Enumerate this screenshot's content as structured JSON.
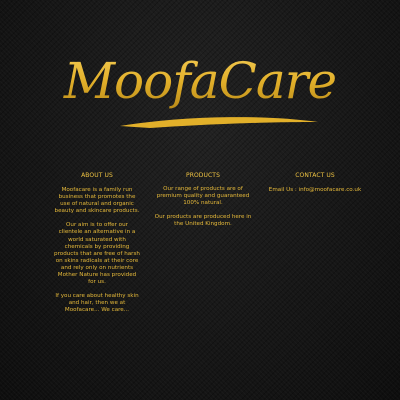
{
  "logo": {
    "text": "MoofaCare",
    "color": "#e3b32b"
  },
  "about": {
    "heading": "ABOUT US",
    "paragraphs": [
      "Moofacare is a family run business that promotes the use of natural and organic beauty and skincare products.",
      "Our aim is to offer our clientele an alternative in a world saturated with chemicals by providing products that are free of harsh on skins radicals at their core and rely only on nutrients Mother Nature has provided for us.",
      "If you care about healthy skin and hair, then we at Moofacare... We care..."
    ]
  },
  "products": {
    "heading": "PRODUCTS",
    "paragraphs": [
      "Our range of products are of premium quality and guaranteed 100% natural.",
      "Our products are produced here in the United Kingdom."
    ]
  },
  "contact": {
    "heading": "CONTACT US",
    "email_line": "Email Us : info@moofacare.co.uk"
  },
  "colors": {
    "background": "#161616",
    "text_gold": "#e8bb3a"
  }
}
